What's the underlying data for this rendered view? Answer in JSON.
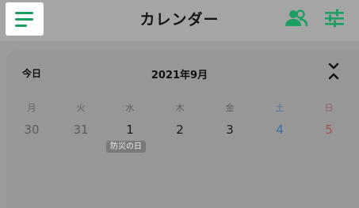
{
  "header": {
    "title": "カレンダー",
    "menu_icon": "menu-icon",
    "people_icon": "people-icon",
    "filter_icon": "sliders-icon",
    "accent_color": "#1f9e63"
  },
  "calendar": {
    "today_label": "今日",
    "month_label": "2021年9月",
    "collapse_icon": "chevrons-collapse-icon",
    "weekdays": [
      "月",
      "火",
      "水",
      "木",
      "金",
      "土",
      "日"
    ],
    "dates": [
      "30",
      "31",
      "1",
      "2",
      "3",
      "4",
      "5"
    ],
    "holiday_label": "防災の日",
    "saturday_color": "#3b6fa8",
    "sunday_color": "#a45050"
  }
}
